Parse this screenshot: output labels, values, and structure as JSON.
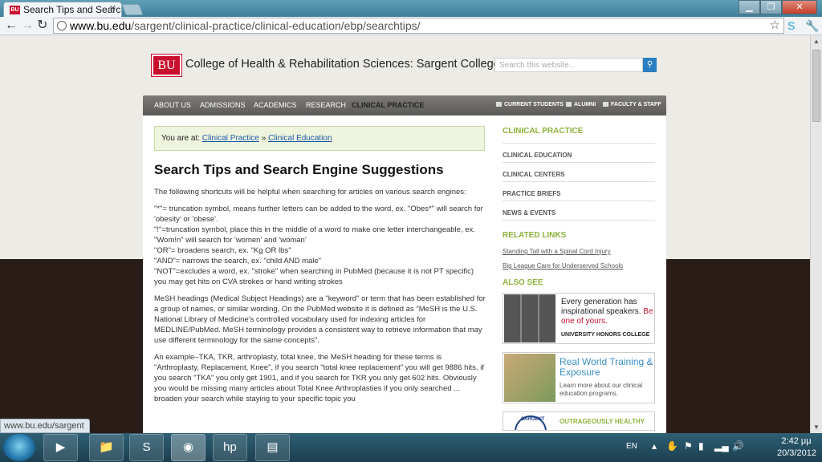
{
  "browser": {
    "tab_title": "Search Tips and Searc",
    "tab_favicon": "BU",
    "url_host": "www.bu.edu",
    "url_path": "/sargent/clinical-practice/clinical-education/ebp/searchtips/",
    "status_url": "www.bu.edu/sargent"
  },
  "header": {
    "logo": "BU",
    "college_name": "College of Health & Rehabilitation Sciences: Sargent College",
    "search_placeholder": "Search this website..."
  },
  "nav": {
    "items": [
      "ABOUT US",
      "ADMISSIONS",
      "ACADEMICS",
      "RESEARCH",
      "CLINICAL PRACTICE"
    ],
    "util": [
      "CURRENT STUDENTS",
      "ALUMNI",
      "FACULTY & STAFF"
    ]
  },
  "breadcrumb": {
    "prefix": "You are at:",
    "link1": "Clinical Practice",
    "sep": "»",
    "link2": "Clinical Education"
  },
  "main": {
    "title": "Search Tips and Search Engine Suggestions",
    "intro": "The following shortcuts will be helpful when searching for articles on various search engines:",
    "tips": [
      "\"*\"= truncation symbol, means further letters can be added to the word, ex. \"Obes*\" will search for 'obesity' or 'obese'.",
      "\"!\"=truncation symbol, place this in the middle of a word to make one letter interchangeable, ex. \"Wom!n\" will search for 'women' and 'woman'",
      "\"OR\"= broadens search, ex. \"Kg OR lbs\"",
      "\"AND\"= narrows the search, ex. \"child AND male\"",
      "\"NOT\"=excludes a word, ex. \"stroke\" when searching in PubMed (because it is not PT specific) you may get hits on CVA strokes or hand writing strokes"
    ],
    "mesh": "MeSH headings (Medical Subject Headings) are a \"keyword\" or term that has been established for a group of names, or similar wording, On the PubMed website it is defined as \"MeSH is the U.S. National Library of Medicine's controlled vocabulary used for indexing articles for MEDLINE/PubMed. MeSH terminology provides a consistent way to retrieve information that may use different terminology for the same concepts\".",
    "example": "An example–TKA, TKR, arthroplasty, total knee, the MeSH heading for these terms is \"Arthroplasty, Replacement, Knee\", if you search \"total knee replacement\" you will get 9886 hits, if you search \"TKA\" you only get 1901, and if you search for TKR you only get 602 hits. Obviously you would be missing many articles about Total Knee Arthroplasties if you only searched ... broaden your search while staying to your specific topic you"
  },
  "sidebar": {
    "section_title": "CLINICAL PRACTICE",
    "items": [
      "CLINICAL EDUCATION",
      "CLINICAL CENTERS",
      "PRACTICE BRIEFS",
      "NEWS & EVENTS"
    ],
    "related_title": "RELATED LINKS",
    "related": [
      "Standing Tall with a Spinal Cord Injury",
      "Big League Care for Underserved Schools"
    ],
    "also_title": "ALSO SEE",
    "promo1": {
      "line": "Every generation has inspirational speakers.",
      "red": "Be one of yours.",
      "tag": "UNIVERSITY HONORS COLLEGE"
    },
    "promo2": {
      "big": "Real World Training & Exposure",
      "small": "Learn more about our clinical education programs."
    },
    "promo3": {
      "seal": "SARGENT",
      "text": "OUTRAGEOUSLY HEALTHY"
    }
  },
  "taskbar": {
    "lang": "EN",
    "time": "2:42 μμ",
    "date": "20/3/2012"
  }
}
